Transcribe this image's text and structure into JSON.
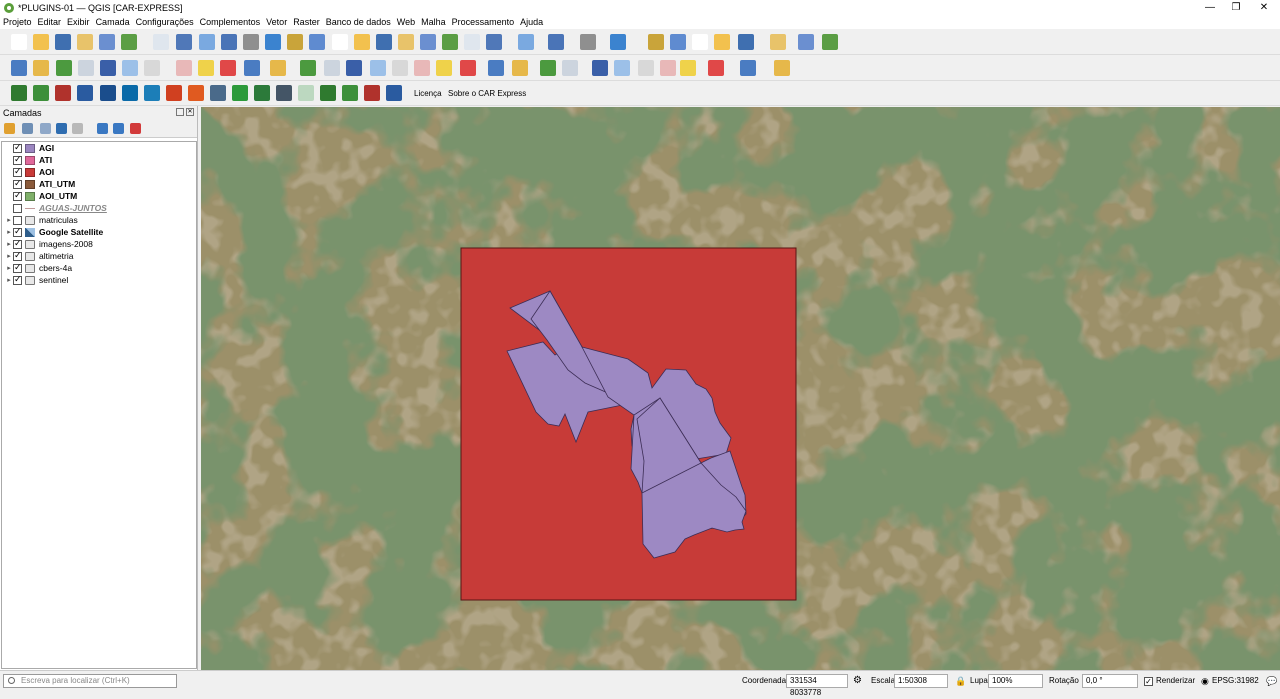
{
  "window": {
    "title": "*PLUGINS-01 — QGIS [CAR-EXPRESS]"
  },
  "menu": [
    "Projeto",
    "Editar",
    "Exibir",
    "Camada",
    "Configurações",
    "Complementos",
    "Vetor",
    "Raster",
    "Banco de dados",
    "Web",
    "Malha",
    "Processamento",
    "Ajuda"
  ],
  "plugin_toolbar": {
    "licenca": "Licença",
    "sobre": "Sobre o CAR Express"
  },
  "layers_panel": {
    "title": "Camadas",
    "layers": [
      {
        "name": "AGI",
        "checked": true,
        "color": "#9b86c0"
      },
      {
        "name": "ATI",
        "checked": true,
        "color": "#e0689a"
      },
      {
        "name": "AOI",
        "checked": true,
        "color": "#c83a38"
      },
      {
        "name": "ATI_UTM",
        "checked": true,
        "color": "#8a5a3a"
      },
      {
        "name": "AOI_UTM",
        "checked": true,
        "color": "#7fb06a"
      },
      {
        "name": "AGUAS-JUNTOS",
        "checked": false
      },
      {
        "name": "matriculas",
        "checked": false
      },
      {
        "name": "Google Satellite",
        "checked": true
      },
      {
        "name": "imagens-2008",
        "checked": true
      },
      {
        "name": "altimetria",
        "checked": true
      },
      {
        "name": "cbers-4a",
        "checked": true
      },
      {
        "name": "sentinel",
        "checked": true
      }
    ]
  },
  "map": {
    "aoi_color": "#c73b38",
    "parcel_color": "#9d89c3"
  },
  "status": {
    "locator_placeholder": "Escreva para localizar (Ctrl+K)",
    "coord_label": "Coordenada",
    "coord_value": "331534  8033778",
    "scale_label": "Escala",
    "scale_value": "1:50308",
    "lupa_label": "Lupa",
    "lupa_value": "100%",
    "rot_label": "Rotação",
    "rot_value": "0,0 °",
    "render_label": "Renderizar",
    "epsg": "EPSG:31982"
  }
}
